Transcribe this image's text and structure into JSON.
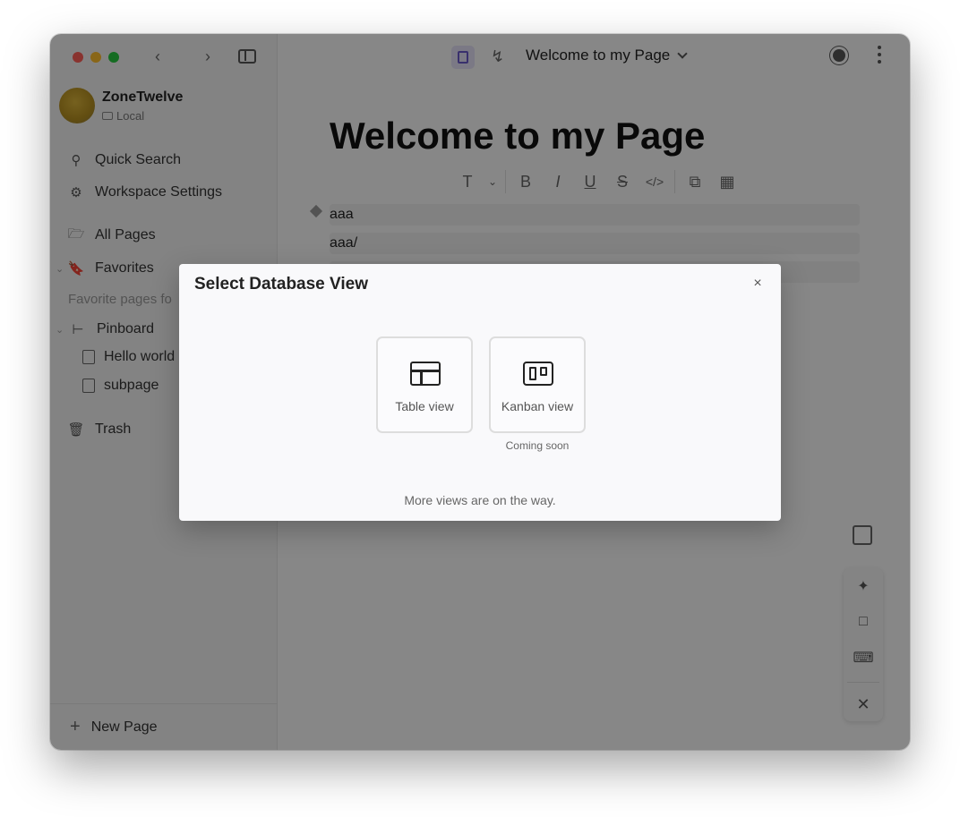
{
  "workspace": {
    "name": "ZoneTwelve",
    "storage": "Local"
  },
  "sidebar": {
    "quick_search": "Quick Search",
    "workspace_settings": "Workspace Settings",
    "all_pages": "All Pages",
    "favorites": "Favorites",
    "favorites_hint": "Favorite pages fo",
    "pinboard": "Pinboard",
    "pages": [
      "Hello world",
      "subpage"
    ],
    "trash": "Trash",
    "new_page": "New Page"
  },
  "topbar": {
    "page_title": "Welcome to my Page"
  },
  "editor": {
    "title": "Welcome to my Page",
    "blocks": [
      "aaa",
      "aaa/",
      ""
    ]
  },
  "modal": {
    "title": "Select Database View",
    "close": "×",
    "views": [
      {
        "label": "Table view"
      },
      {
        "label": "Kanban view",
        "note": "Coming soon"
      }
    ],
    "footer": "More views are on the way."
  }
}
